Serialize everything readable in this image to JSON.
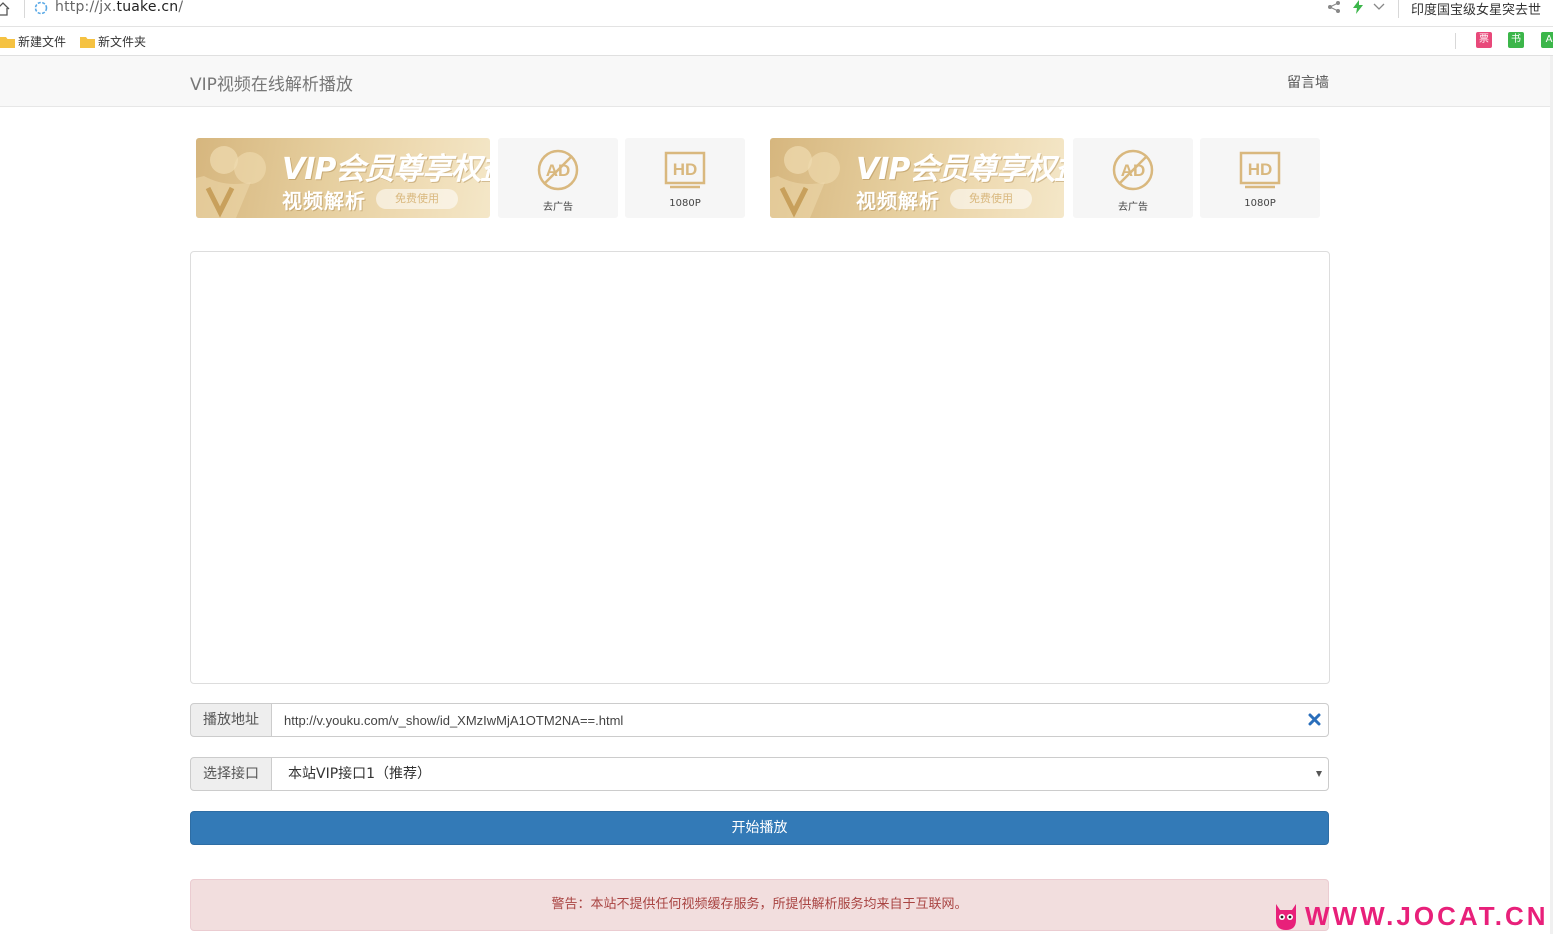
{
  "browser": {
    "url_prefix": "http://jx.",
    "url_domain": "tuake.cn",
    "url_suffix": "/",
    "news_ticker": "印度国宝级女星突去世"
  },
  "bookmarks": [
    {
      "label": "新建文件"
    },
    {
      "label": "新文件夹"
    }
  ],
  "extensions": [
    {
      "icon": "calendar-extension-icon",
      "color": "#e8497a",
      "glyph": "票"
    },
    {
      "icon": "book-extension-icon",
      "color": "#3cb64a",
      "glyph": "书"
    },
    {
      "icon": "a-extension-icon",
      "color": "#3cb64a",
      "glyph": "A"
    }
  ],
  "navbar": {
    "brand": "VIP视频在线解析播放",
    "link": "留言墙"
  },
  "promos": [
    {
      "title": "VIP会员尊享权益",
      "sub": "视频解析",
      "pill": "免费使用",
      "features": [
        {
          "icon": "no-ad-icon",
          "caption": "去广告"
        },
        {
          "icon": "hd-icon",
          "caption": "1080P"
        }
      ]
    },
    {
      "title": "VIP会员尊享权益",
      "sub": "视频解析",
      "pill": "免费使用",
      "features": [
        {
          "icon": "no-ad-icon",
          "caption": "去广告"
        },
        {
          "icon": "hd-icon",
          "caption": "1080P"
        }
      ]
    }
  ],
  "form": {
    "url_label": "播放地址",
    "url_value": "http://v.youku.com/v_show/id_XMzIwMjA1OTM2NA==.html",
    "api_label": "选择接口",
    "api_selected": "本站VIP接口1（推荐）",
    "play_button": "开始播放"
  },
  "alert": {
    "text": "警告：本站不提供任何视频缓存服务，所提供解析服务均来自于互联网。"
  },
  "watermark": {
    "text": "WWW.JOCAT.CN"
  },
  "colors": {
    "primary": "#337ab7",
    "alert_bg": "#f2dede",
    "alert_text": "#a94442",
    "gold": "#d9b87e",
    "watermark": "#e8207a"
  }
}
